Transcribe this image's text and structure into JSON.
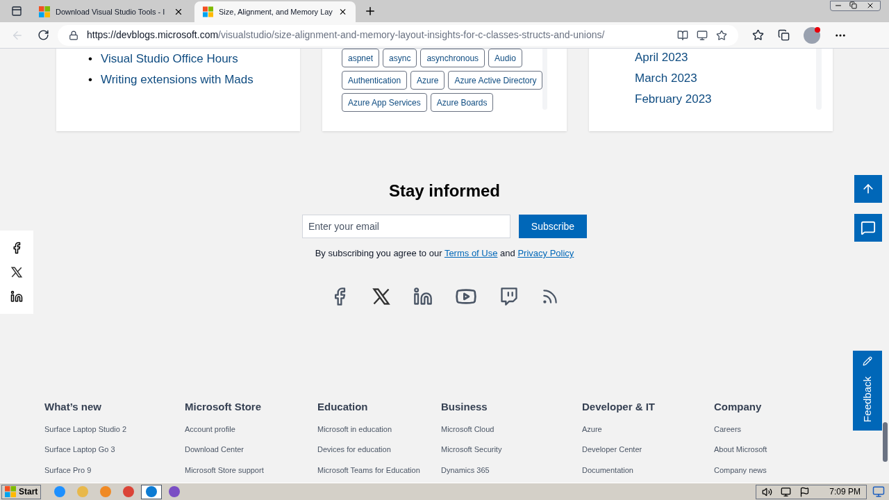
{
  "browser": {
    "tabs": [
      {
        "title": "Download Visual Studio Tools - I",
        "selected": false
      },
      {
        "title": "Size, Alignment, and Memory Lay",
        "selected": true
      }
    ],
    "url_host": "https://devblogs.microsoft.com",
    "url_path": "/visualstudio/size-alignment-and-memory-layout-insights-for-c-classes-structs-and-unions/"
  },
  "cards": {
    "links": [
      {
        "bullet": "•",
        "text": "Visual Studio Office Hours"
      },
      {
        "bullet": "•",
        "text": "Writing extensions with Mads"
      }
    ],
    "tag_rows": [
      [
        "aspnet",
        "async",
        "asynchronous",
        "Audio"
      ],
      [
        "Authentication",
        "Azure",
        "Azure Active Directory"
      ],
      [
        "Azure App Services",
        "Azure Boards"
      ]
    ],
    "archive": [
      "April 2023",
      "March 2023",
      "February 2023"
    ]
  },
  "newsletter": {
    "title": "Stay informed",
    "placeholder": "Enter your email",
    "button": "Subscribe",
    "agree_text": "By subscribing you agree to our",
    "terms": "Terms of Use",
    "and": "and",
    "privacy": "Privacy Policy"
  },
  "feedback": "Feedback",
  "footer": [
    {
      "heading": "What’s new",
      "links": [
        "Surface Laptop Studio 2",
        "Surface Laptop Go 3",
        "Surface Pro 9"
      ]
    },
    {
      "heading": "Microsoft Store",
      "links": [
        "Account profile",
        "Download Center",
        "Microsoft Store support"
      ]
    },
    {
      "heading": "Education",
      "links": [
        "Microsoft in education",
        "Devices for education",
        "Microsoft Teams for Education"
      ]
    },
    {
      "heading": "Business",
      "links": [
        "Microsoft Cloud",
        "Microsoft Security",
        "Dynamics 365"
      ]
    },
    {
      "heading": "Developer & IT",
      "links": [
        "Azure",
        "Developer Center",
        "Documentation"
      ]
    },
    {
      "heading": "Company",
      "links": [
        "Careers",
        "About Microsoft",
        "Company news"
      ]
    }
  ],
  "taskbar": {
    "start": "Start",
    "clock": "7:09 PM",
    "apps": [
      {
        "selected": false
      },
      {
        "selected": false
      },
      {
        "selected": false
      },
      {
        "selected": false
      },
      {
        "selected": true
      },
      {
        "selected": false
      }
    ]
  }
}
